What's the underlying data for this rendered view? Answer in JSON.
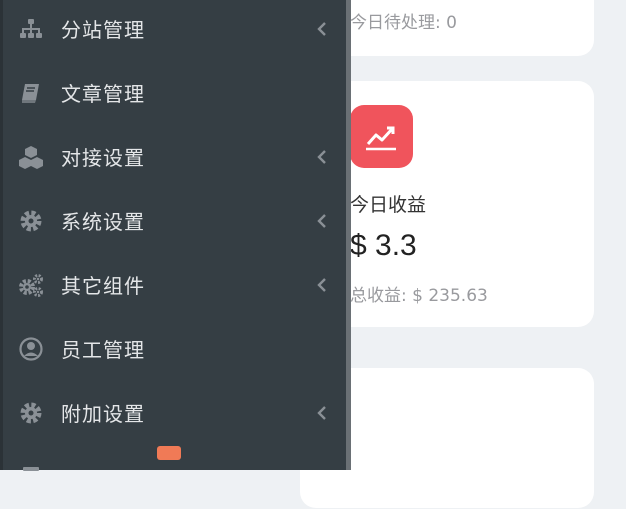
{
  "dashboard": {
    "pending_text": "今日待处理: 0",
    "income": {
      "title": "今日收益",
      "value": "$ 3.3",
      "total": "总收益: $ 235.63"
    }
  },
  "sidebar": {
    "items": [
      {
        "label": "分站管理",
        "icon": "sitemap-icon",
        "has_submenu": true
      },
      {
        "label": "文章管理",
        "icon": "book-icon",
        "has_submenu": false
      },
      {
        "label": "对接设置",
        "icon": "cubes-icon",
        "has_submenu": true
      },
      {
        "label": "系统设置",
        "icon": "gear-icon",
        "has_submenu": true
      },
      {
        "label": "其它组件",
        "icon": "gears-icon",
        "has_submenu": true
      },
      {
        "label": "员工管理",
        "icon": "user-circle-icon",
        "has_submenu": false
      },
      {
        "label": "附加设置",
        "icon": "gear-icon",
        "has_submenu": true
      },
      {
        "label": "",
        "icon": "menu-icon",
        "has_submenu": false
      }
    ]
  },
  "colors": {
    "sidebar_bg": "#353e44",
    "income_icon_bg": "#f0545c",
    "badge": "#f07a56"
  }
}
